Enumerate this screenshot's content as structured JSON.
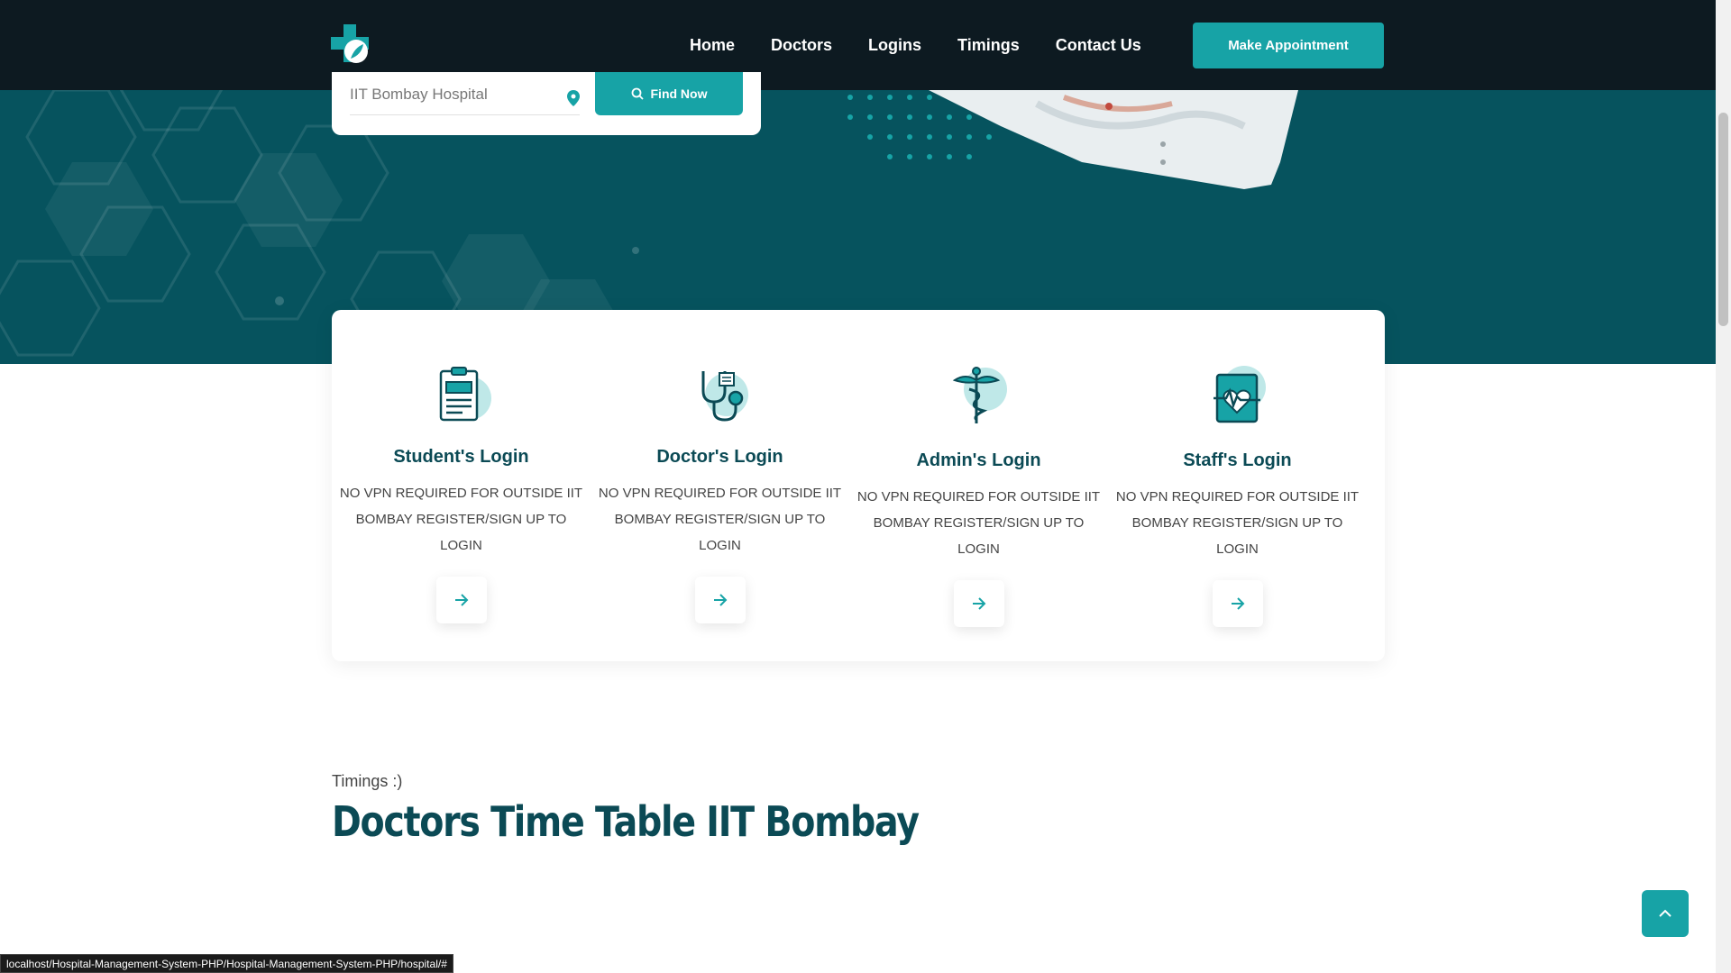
{
  "header": {
    "nav": [
      "Home",
      "Doctors",
      "Logins",
      "Timings",
      "Contact Us"
    ],
    "cta_label": "Make Appointment"
  },
  "search": {
    "location_value": "IIT Bombay Hospital",
    "find_label": "Find Now"
  },
  "logins": [
    {
      "title": "Student's Login",
      "desc": "NO VPN REQUIRED FOR OUTSIDE IIT BOMBAY REGISTER/SIGN UP TO LOGIN",
      "icon": "clipboard-icon"
    },
    {
      "title": "Doctor's Login",
      "desc": "NO VPN REQUIRED FOR OUTSIDE IIT BOMBAY REGISTER/SIGN UP TO LOGIN",
      "icon": "stethoscope-icon"
    },
    {
      "title": "Admin's Login",
      "desc": "NO VPN REQUIRED FOR OUTSIDE IIT BOMBAY REGISTER/SIGN UP TO LOGIN",
      "icon": "caduceus-icon"
    },
    {
      "title": "Staff's Login",
      "desc": "NO VPN REQUIRED FOR OUTSIDE IIT BOMBAY REGISTER/SIGN UP TO LOGIN",
      "icon": "heart-monitor-icon"
    }
  ],
  "timings": {
    "subtitle": "Timings :)",
    "title": "Doctors Time Table IIT Bombay"
  },
  "status_url": "localhost/Hospital-Management-System-PHP/Hospital-Management-System-PHP/hospital/#",
  "colors": {
    "header_bg": "#0d1a21",
    "hero_bg": "#06535e",
    "accent": "#17a3a6",
    "heading": "#0b4a55"
  }
}
